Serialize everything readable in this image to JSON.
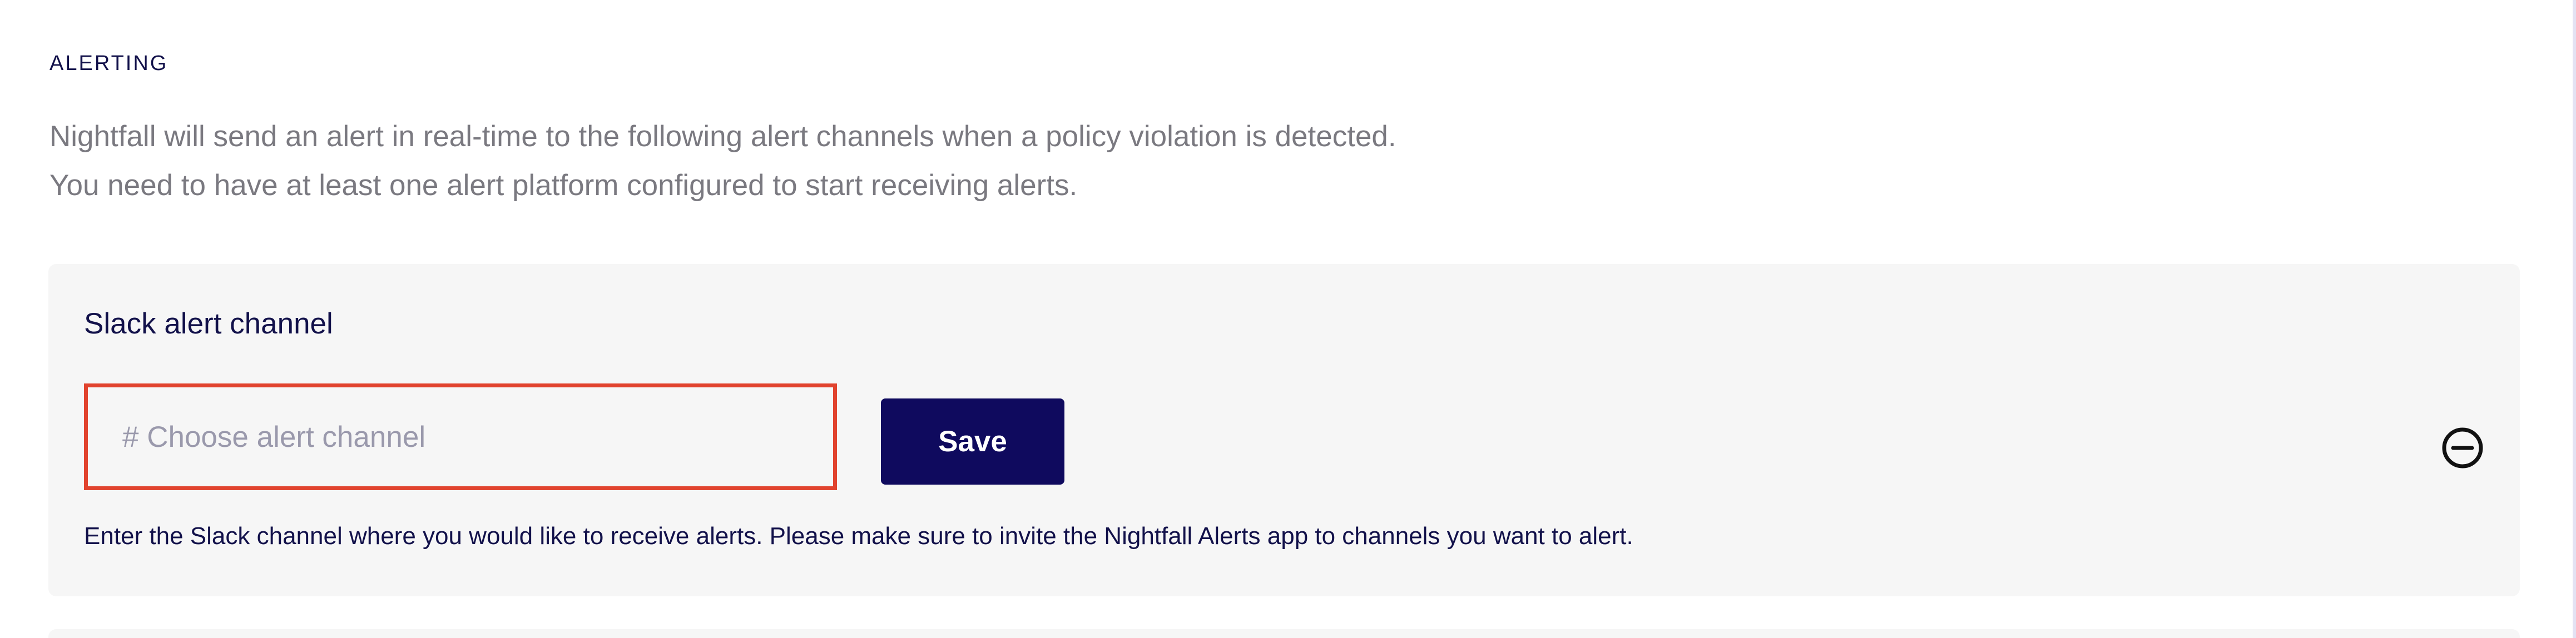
{
  "alerting": {
    "section_title": "ALERTING",
    "description_line1": "Nightfall will send an alert in real-time to the following alert channels when a policy violation is detected.",
    "description_line2": "You need to have at least one alert platform configured to start receiving alerts."
  },
  "slack_card": {
    "title": "Slack alert channel",
    "channel_input": {
      "value": "",
      "placeholder": "# Choose alert channel"
    },
    "save_label": "Save",
    "remove_icon": "minus-circle-icon",
    "helper_text": "Enter the Slack channel where you would like to receive alerts. Please make sure to invite the Nightfall Alerts app to channels you want to alert."
  },
  "colors": {
    "primary_button": "#0f0a5e",
    "highlight_border": "#e1432e",
    "card_background": "#f6f6f6",
    "heading_text": "#12114a",
    "muted_text": "#7a7980"
  }
}
